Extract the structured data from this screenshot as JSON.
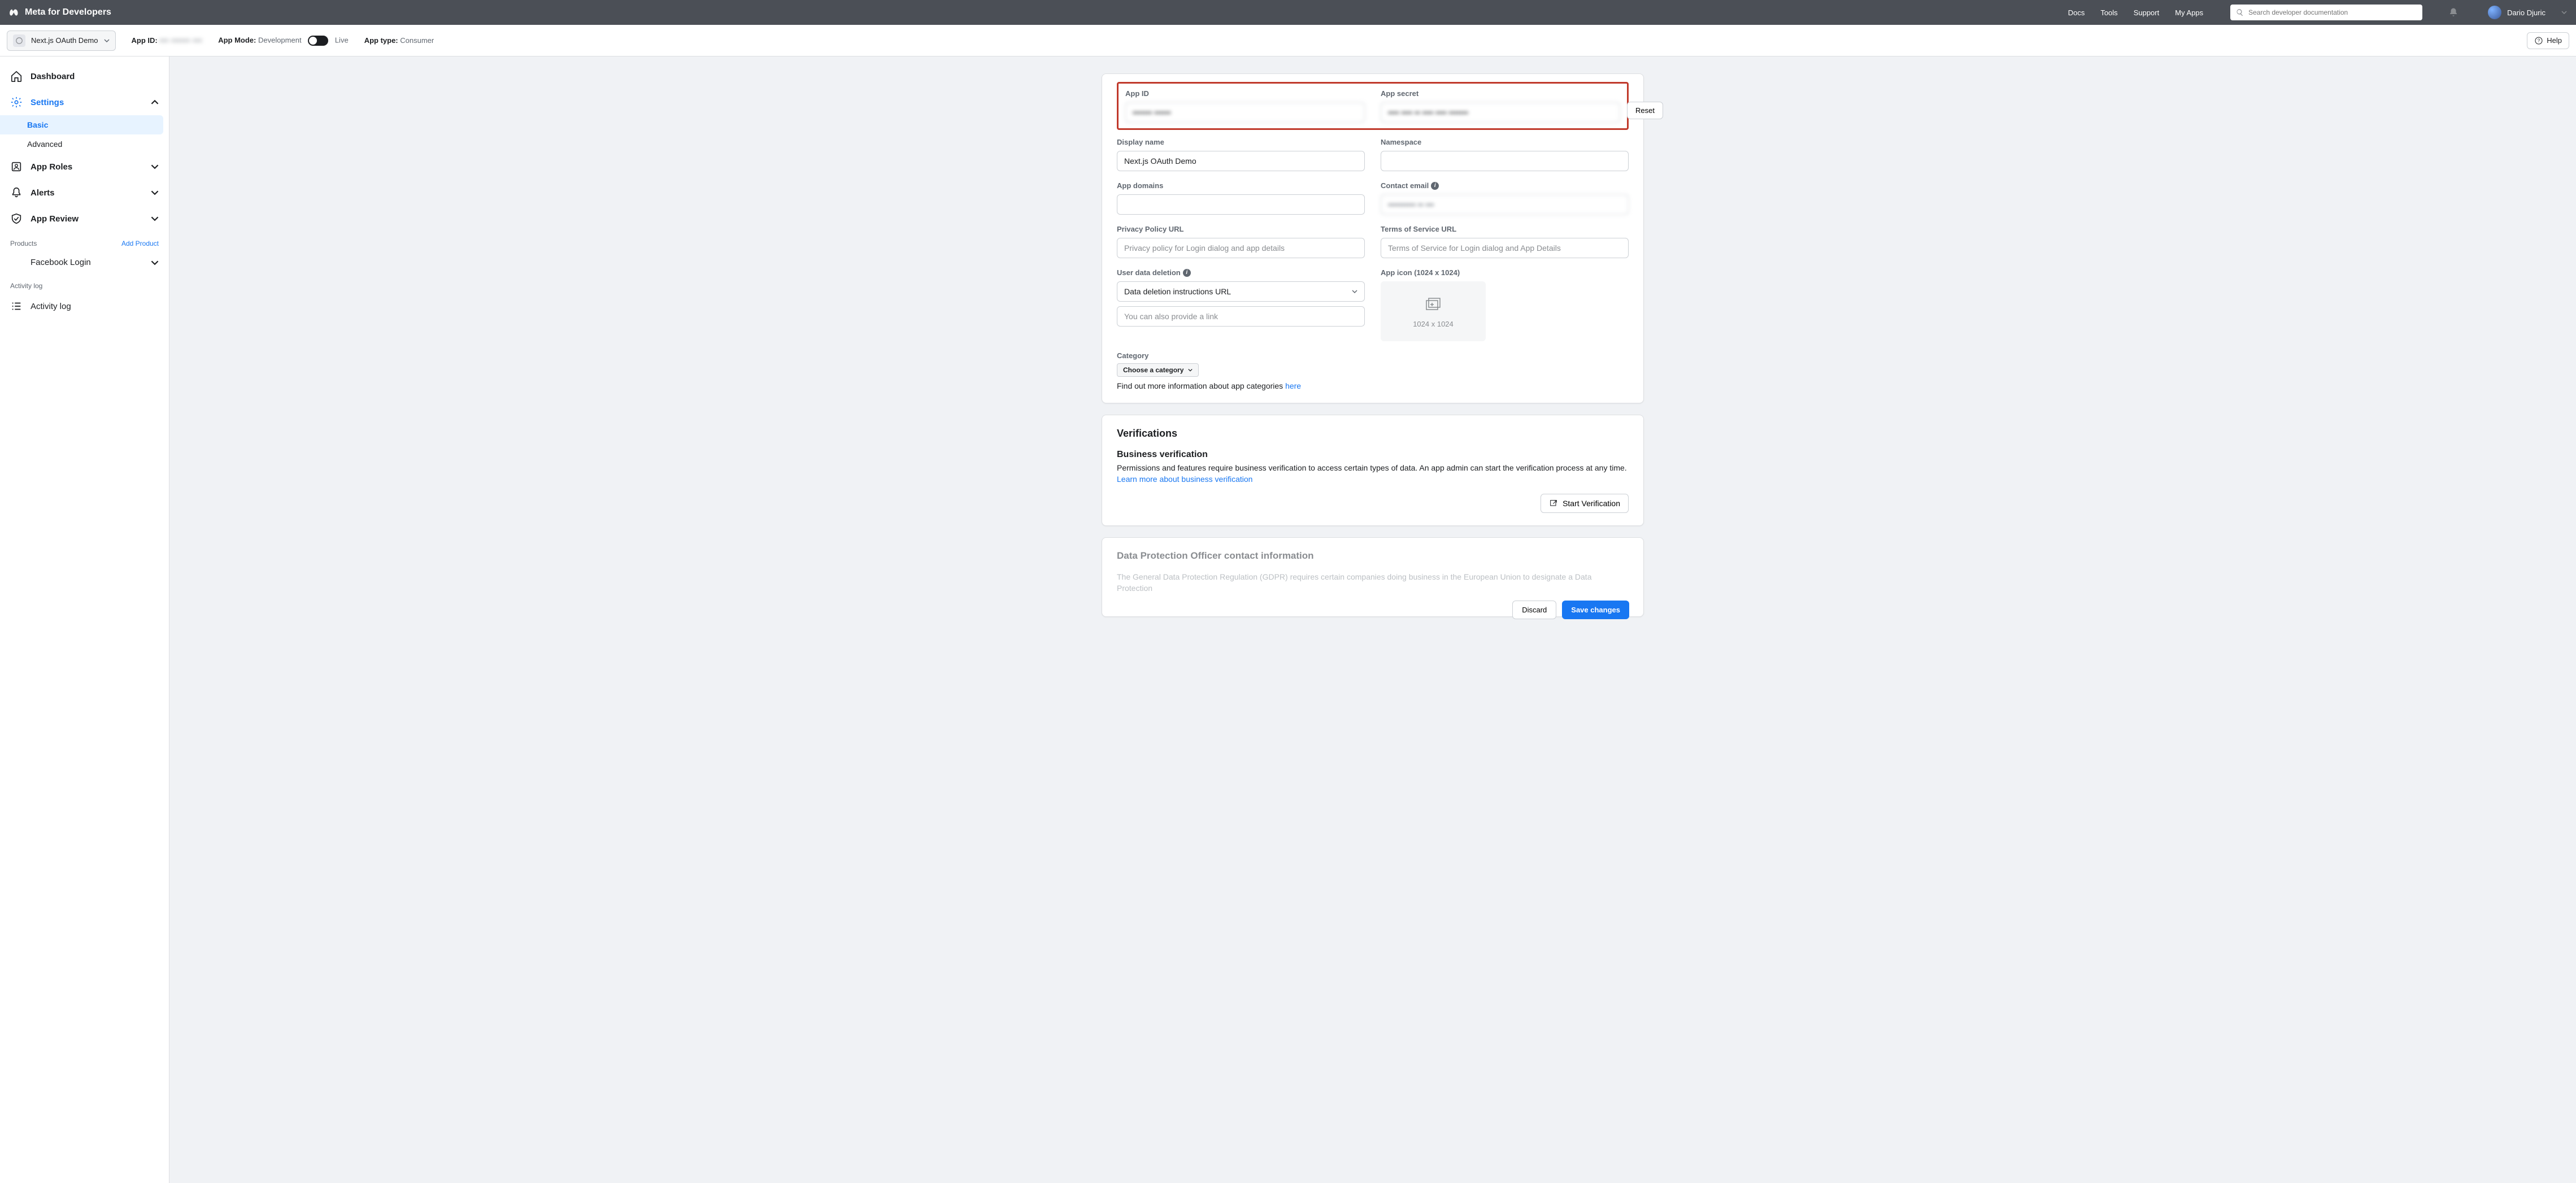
{
  "topbar": {
    "brand": "Meta for Developers",
    "nav": {
      "docs": "Docs",
      "tools": "Tools",
      "support": "Support",
      "myapps": "My Apps"
    },
    "search_placeholder": "Search developer documentation",
    "username": "Dario Djuric"
  },
  "app_header": {
    "app_name": "Next.js OAuth Demo",
    "app_id_label": "App ID:",
    "app_id_value": "••• •••••• •••",
    "mode_label": "App Mode:",
    "mode_value": "Development",
    "live_label": "Live",
    "type_label": "App type:",
    "type_value": "Consumer",
    "help": "Help"
  },
  "sidebar": {
    "dashboard": "Dashboard",
    "settings": "Settings",
    "basic": "Basic",
    "advanced": "Advanced",
    "app_roles": "App Roles",
    "alerts": "Alerts",
    "app_review": "App Review",
    "products_label": "Products",
    "add_product": "Add Product",
    "facebook_login": "Facebook Login",
    "activity_log_label": "Activity log",
    "activity_log": "Activity log"
  },
  "form": {
    "app_id_label": "App ID",
    "app_id_value": "••••••• ••••••",
    "app_secret_label": "App secret",
    "app_secret_value": "•••• •••• •• •••• •••• •••••••",
    "reset": "Reset",
    "display_name_label": "Display name",
    "display_name_value": "Next.js OAuth Demo",
    "namespace_label": "Namespace",
    "app_domains_label": "App domains",
    "contact_email_label": "Contact email",
    "contact_email_value": "•••••••••• •• •••",
    "privacy_label": "Privacy Policy URL",
    "privacy_placeholder": "Privacy policy for Login dialog and app details",
    "tos_label": "Terms of Service URL",
    "tos_placeholder": "Terms of Service for Login dialog and App Details",
    "udd_label": "User data deletion",
    "udd_select": "Data deletion instructions URL",
    "udd_placeholder": "You can also provide a link",
    "icon_label": "App icon (1024 x 1024)",
    "icon_size": "1024 x 1024",
    "category_label": "Category",
    "category_select": "Choose a category",
    "category_desc": "Find out more information about app categories ",
    "category_link": "here"
  },
  "verifications": {
    "title": "Verifications",
    "biz_title": "Business verification",
    "biz_desc": "Permissions and features require business verification to access certain types of data. An app admin can start the verification process at any time.",
    "biz_link": "Learn more about business verification",
    "start_btn": "Start Verification"
  },
  "dpo": {
    "title": "Data Protection Officer contact information",
    "desc": "The General Data Protection Regulation (GDPR) requires certain companies doing business in the European Union to designate a Data Protection"
  },
  "footer": {
    "discard": "Discard",
    "save": "Save changes"
  }
}
